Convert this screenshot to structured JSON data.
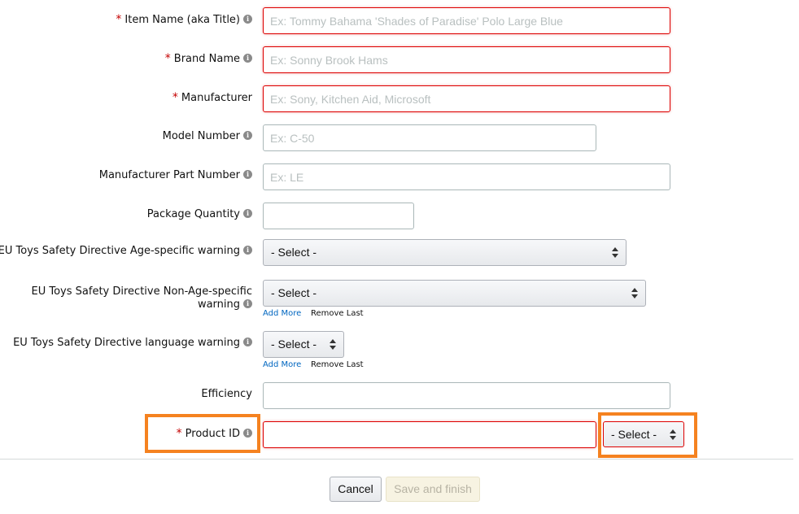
{
  "form": {
    "fields": [
      {
        "label": "Item Name (aka Title)",
        "required": true,
        "placeholder": "Ex: Tommy Bahama 'Shades of Paradise' Polo Large Blue"
      },
      {
        "label": "Brand Name",
        "required": true,
        "placeholder": "Ex: Sonny Brook Hams"
      },
      {
        "label": "Manufacturer",
        "required": true,
        "placeholder": "Ex: Sony, Kitchen Aid, Microsoft"
      },
      {
        "label": "Model Number",
        "required": false,
        "placeholder": "Ex: C-50"
      },
      {
        "label": "Manufacturer Part Number",
        "required": false,
        "placeholder": "Ex: LE"
      },
      {
        "label": "Package Quantity",
        "required": false,
        "placeholder": ""
      },
      {
        "label": "EU Toys Safety Directive Age-specific warning",
        "required": false,
        "select_value": "- Select -"
      },
      {
        "label": "EU Toys Safety Directive Non-Age-specific warning",
        "required": false,
        "select_value": "- Select -"
      },
      {
        "label": "EU Toys Safety Directive language warning",
        "required": false,
        "select_value": "- Select -"
      },
      {
        "label": "Efficiency",
        "required": false,
        "placeholder": ""
      },
      {
        "label": "Product ID",
        "required": true,
        "placeholder": "",
        "select_value": "- Select -"
      }
    ],
    "required_marker": "*",
    "info_icon": "i",
    "add_more_label": "Add More",
    "remove_last_label": "Remove Last"
  },
  "footer": {
    "cancel_label": "Cancel",
    "save_label": "Save and finish"
  },
  "colors": {
    "required": "#c40000",
    "error_border": "#dd0000",
    "highlight": "#f58220",
    "link": "#0066c0"
  },
  "icons": {
    "info": "info-icon",
    "select_arrows": "sort-arrows-icon"
  }
}
